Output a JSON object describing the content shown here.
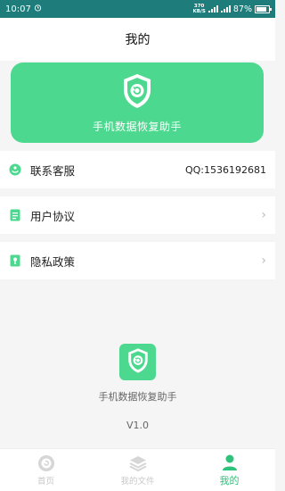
{
  "status_bar": {
    "time": "10:07",
    "speed_value": "370",
    "speed_unit": "KB/S",
    "battery": "87%",
    "battery_level": 0.87
  },
  "header": {
    "title": "我的"
  },
  "banner": {
    "label": "手机数据恢复助手"
  },
  "menu": {
    "contact": {
      "label": "联系客服",
      "value": "QQ:1536192681"
    },
    "agreement": {
      "label": "用户协议",
      "chevron": "›"
    },
    "privacy": {
      "label": "隐私政策",
      "chevron": "›"
    }
  },
  "about": {
    "app_name": "手机数据恢复助手",
    "version": "V1.0"
  },
  "tabbar": {
    "home": "首页",
    "files": "我的文件",
    "mine": "我的"
  },
  "colors": {
    "accent": "#4cd98f",
    "active_tab": "#2fc27a",
    "status_bar": "#1e7d7b"
  },
  "icons": [
    "alarm-icon",
    "signal-icon",
    "battery-icon",
    "shield-restore-icon",
    "customer-service-icon",
    "document-icon",
    "privacy-icon",
    "chevron-right-icon",
    "home-icon",
    "layers-icon",
    "person-icon"
  ]
}
